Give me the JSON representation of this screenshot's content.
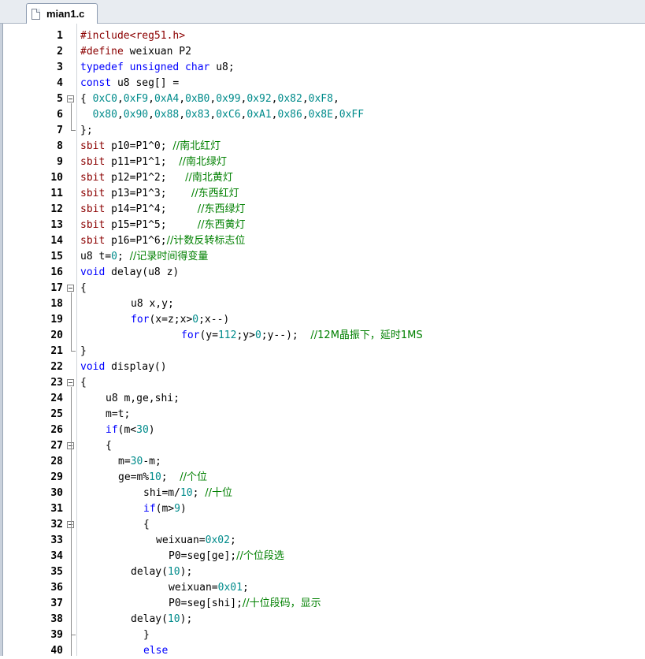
{
  "tab": {
    "label": "mian1.c",
    "icon": "file-icon"
  },
  "colors": {
    "keyword": "#0000ff",
    "preprocessor": "#8b0000",
    "number": "#008b8b",
    "comment": "#008000",
    "plain": "#000000"
  },
  "lines": [
    {
      "n": "1",
      "indent": 0,
      "fold": "",
      "tokens": [
        [
          "pp",
          "#include<reg51.h>"
        ]
      ]
    },
    {
      "n": "2",
      "indent": 0,
      "fold": "",
      "tokens": [
        [
          "pp",
          "#define "
        ],
        [
          "plain",
          "weixuan P2"
        ]
      ]
    },
    {
      "n": "3",
      "indent": 0,
      "fold": "",
      "tokens": [
        [
          "kw",
          "typedef unsigned char "
        ],
        [
          "plain",
          "u8;"
        ]
      ]
    },
    {
      "n": "4",
      "indent": 0,
      "fold": "",
      "tokens": [
        [
          "kw",
          "const "
        ],
        [
          "plain",
          "u8 seg[] ="
        ]
      ]
    },
    {
      "n": "5",
      "indent": 0,
      "fold": "open",
      "tokens": [
        [
          "plain",
          "{ "
        ],
        [
          "num",
          "0xC0"
        ],
        [
          "plain",
          ","
        ],
        [
          "num",
          "0xF9"
        ],
        [
          "plain",
          ","
        ],
        [
          "num",
          "0xA4"
        ],
        [
          "plain",
          ","
        ],
        [
          "num",
          "0xB0"
        ],
        [
          "plain",
          ","
        ],
        [
          "num",
          "0x99"
        ],
        [
          "plain",
          ","
        ],
        [
          "num",
          "0x92"
        ],
        [
          "plain",
          ","
        ],
        [
          "num",
          "0x82"
        ],
        [
          "plain",
          ","
        ],
        [
          "num",
          "0xF8"
        ],
        [
          "plain",
          ","
        ]
      ]
    },
    {
      "n": "6",
      "indent": 0,
      "fold": "mid",
      "tokens": [
        [
          "plain",
          "  "
        ],
        [
          "num",
          "0x80"
        ],
        [
          "plain",
          ","
        ],
        [
          "num",
          "0x90"
        ],
        [
          "plain",
          ","
        ],
        [
          "num",
          "0x88"
        ],
        [
          "plain",
          ","
        ],
        [
          "num",
          "0x83"
        ],
        [
          "plain",
          ","
        ],
        [
          "num",
          "0xC6"
        ],
        [
          "plain",
          ","
        ],
        [
          "num",
          "0xA1"
        ],
        [
          "plain",
          ","
        ],
        [
          "num",
          "0x86"
        ],
        [
          "plain",
          ","
        ],
        [
          "num",
          "0x8E"
        ],
        [
          "plain",
          ","
        ],
        [
          "num",
          "0xFF"
        ]
      ]
    },
    {
      "n": "7",
      "indent": 0,
      "fold": "end",
      "tokens": [
        [
          "plain",
          "};"
        ]
      ]
    },
    {
      "n": "8",
      "indent": 0,
      "fold": "",
      "tokens": [
        [
          "sbit",
          "sbit "
        ],
        [
          "plain",
          "p10=P1^0; "
        ],
        [
          "cm",
          "//南北红灯"
        ]
      ]
    },
    {
      "n": "9",
      "indent": 0,
      "fold": "",
      "tokens": [
        [
          "sbit",
          "sbit "
        ],
        [
          "plain",
          "p11=P1^1;  "
        ],
        [
          "cm",
          "//南北绿灯"
        ]
      ]
    },
    {
      "n": "10",
      "indent": 0,
      "fold": "",
      "tokens": [
        [
          "sbit",
          "sbit "
        ],
        [
          "plain",
          "p12=P1^2;   "
        ],
        [
          "cm",
          "//南北黄灯"
        ]
      ]
    },
    {
      "n": "11",
      "indent": 0,
      "fold": "",
      "tokens": [
        [
          "sbit",
          "sbit "
        ],
        [
          "plain",
          "p13=P1^3;    "
        ],
        [
          "cm",
          "//东西红灯"
        ]
      ]
    },
    {
      "n": "12",
      "indent": 0,
      "fold": "",
      "tokens": [
        [
          "sbit",
          "sbit "
        ],
        [
          "plain",
          "p14=P1^4;     "
        ],
        [
          "cm",
          "//东西绿灯"
        ]
      ]
    },
    {
      "n": "13",
      "indent": 0,
      "fold": "",
      "tokens": [
        [
          "sbit",
          "sbit "
        ],
        [
          "plain",
          "p15=P1^5;     "
        ],
        [
          "cm",
          "//东西黄灯"
        ]
      ]
    },
    {
      "n": "14",
      "indent": 0,
      "fold": "",
      "tokens": [
        [
          "sbit",
          "sbit "
        ],
        [
          "plain",
          "p16=P1^6;"
        ],
        [
          "cm",
          "//计数反转标志位"
        ]
      ]
    },
    {
      "n": "15",
      "indent": 0,
      "fold": "",
      "tokens": [
        [
          "plain",
          "u8 t="
        ],
        [
          "num",
          "0"
        ],
        [
          "plain",
          "; "
        ],
        [
          "cm",
          "//记录时间得变量"
        ]
      ]
    },
    {
      "n": "16",
      "indent": 0,
      "fold": "",
      "tokens": [
        [
          "kw",
          "void "
        ],
        [
          "plain",
          "delay(u8 z)"
        ]
      ]
    },
    {
      "n": "17",
      "indent": 0,
      "fold": "open",
      "tokens": [
        [
          "plain",
          "{"
        ]
      ]
    },
    {
      "n": "18",
      "indent": 8,
      "fold": "mid",
      "tokens": [
        [
          "plain",
          "u8 x,y;"
        ]
      ]
    },
    {
      "n": "19",
      "indent": 8,
      "fold": "mid",
      "tokens": [
        [
          "kw",
          "for"
        ],
        [
          "plain",
          "(x=z;x>"
        ],
        [
          "num",
          "0"
        ],
        [
          "plain",
          ";x--)"
        ]
      ]
    },
    {
      "n": "20",
      "indent": 16,
      "fold": "mid",
      "tokens": [
        [
          "kw",
          "for"
        ],
        [
          "plain",
          "(y="
        ],
        [
          "num",
          "112"
        ],
        [
          "plain",
          ";y>"
        ],
        [
          "num",
          "0"
        ],
        [
          "plain",
          ";y--);  "
        ],
        [
          "cm",
          "//12M晶振下，延时1MS"
        ]
      ]
    },
    {
      "n": "21",
      "indent": 0,
      "fold": "end",
      "tokens": [
        [
          "plain",
          "}"
        ]
      ]
    },
    {
      "n": "22",
      "indent": 0,
      "fold": "",
      "tokens": [
        [
          "kw",
          "void "
        ],
        [
          "plain",
          "display()"
        ]
      ]
    },
    {
      "n": "23",
      "indent": 0,
      "fold": "open",
      "tokens": [
        [
          "plain",
          "{"
        ]
      ]
    },
    {
      "n": "24",
      "indent": 4,
      "fold": "mid",
      "tokens": [
        [
          "plain",
          "u8 m,ge,shi;"
        ]
      ]
    },
    {
      "n": "25",
      "indent": 4,
      "fold": "mid",
      "tokens": [
        [
          "plain",
          "m=t;"
        ]
      ]
    },
    {
      "n": "26",
      "indent": 4,
      "fold": "mid",
      "tokens": [
        [
          "kw",
          "if"
        ],
        [
          "plain",
          "(m<"
        ],
        [
          "num",
          "30"
        ],
        [
          "plain",
          ")"
        ]
      ]
    },
    {
      "n": "27",
      "indent": 4,
      "fold": "open",
      "tokens": [
        [
          "plain",
          "{"
        ]
      ]
    },
    {
      "n": "28",
      "indent": 6,
      "fold": "mid",
      "tokens": [
        [
          "plain",
          "m="
        ],
        [
          "num",
          "30"
        ],
        [
          "plain",
          "-m;"
        ]
      ]
    },
    {
      "n": "29",
      "indent": 6,
      "fold": "mid",
      "tokens": [
        [
          "plain",
          "ge=m%"
        ],
        [
          "num",
          "10"
        ],
        [
          "plain",
          ";  "
        ],
        [
          "cm",
          "//个位"
        ]
      ]
    },
    {
      "n": "30",
      "indent": 10,
      "fold": "mid",
      "tokens": [
        [
          "plain",
          "shi=m/"
        ],
        [
          "num",
          "10"
        ],
        [
          "plain",
          "; "
        ],
        [
          "cm",
          "//十位"
        ]
      ]
    },
    {
      "n": "31",
      "indent": 10,
      "fold": "mid",
      "tokens": [
        [
          "kw",
          "if"
        ],
        [
          "plain",
          "(m>"
        ],
        [
          "num",
          "9"
        ],
        [
          "plain",
          ")"
        ]
      ]
    },
    {
      "n": "32",
      "indent": 10,
      "fold": "open",
      "tokens": [
        [
          "plain",
          "{"
        ]
      ]
    },
    {
      "n": "33",
      "indent": 12,
      "fold": "mid",
      "tokens": [
        [
          "plain",
          "weixuan="
        ],
        [
          "num",
          "0x02"
        ],
        [
          "plain",
          ";"
        ]
      ]
    },
    {
      "n": "34",
      "indent": 14,
      "fold": "mid",
      "tokens": [
        [
          "plain",
          "P0=seg[ge];"
        ],
        [
          "cm",
          "//个位段选"
        ]
      ]
    },
    {
      "n": "35",
      "indent": 8,
      "fold": "mid",
      "tokens": [
        [
          "plain",
          "delay("
        ],
        [
          "num",
          "10"
        ],
        [
          "plain",
          ");"
        ]
      ]
    },
    {
      "n": "36",
      "indent": 14,
      "fold": "mid",
      "tokens": [
        [
          "plain",
          "weixuan="
        ],
        [
          "num",
          "0x01"
        ],
        [
          "plain",
          ";"
        ]
      ]
    },
    {
      "n": "37",
      "indent": 14,
      "fold": "mid",
      "tokens": [
        [
          "plain",
          "P0=seg[shi];"
        ],
        [
          "cm",
          "//十位段码，显示"
        ]
      ]
    },
    {
      "n": "38",
      "indent": 8,
      "fold": "mid",
      "tokens": [
        [
          "plain",
          "delay("
        ],
        [
          "num",
          "10"
        ],
        [
          "plain",
          ");"
        ]
      ]
    },
    {
      "n": "39",
      "indent": 10,
      "fold": "end",
      "tokens": [
        [
          "plain",
          "}"
        ]
      ]
    },
    {
      "n": "40",
      "indent": 10,
      "fold": "mid",
      "tokens": [
        [
          "kw",
          "else"
        ]
      ]
    }
  ]
}
